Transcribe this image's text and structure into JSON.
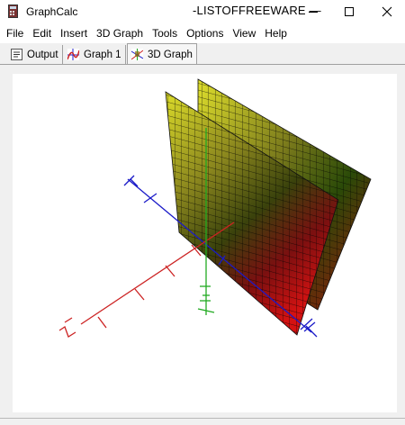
{
  "window": {
    "app_name": "GraphCalc",
    "title": "-LISTOFFREEWARE —",
    "icon": "graphcalc-app-icon",
    "controls": {
      "minimize_icon": "minimize-icon",
      "maximize_icon": "maximize-icon",
      "close_icon": "close-icon"
    }
  },
  "menubar": {
    "items": [
      "File",
      "Edit",
      "Insert",
      "3D Graph",
      "Tools",
      "Options",
      "View",
      "Help"
    ]
  },
  "tabs": [
    {
      "label": "Output",
      "icon": "output-icon",
      "active": false
    },
    {
      "label": "Graph 1",
      "icon": "graph-icon",
      "active": false
    },
    {
      "label": "3D Graph",
      "icon": "3d-graph-icon",
      "active": true
    }
  ],
  "graph3d": {
    "axis_colors": {
      "x": "#cc2222",
      "y": "#22aa22",
      "z": "#1a1ac8"
    },
    "surface_gradient": [
      "#e6e62a",
      "#6e6e1e",
      "#1e4e08",
      "#8b0e0e",
      "#d41010"
    ],
    "planes": 2
  }
}
